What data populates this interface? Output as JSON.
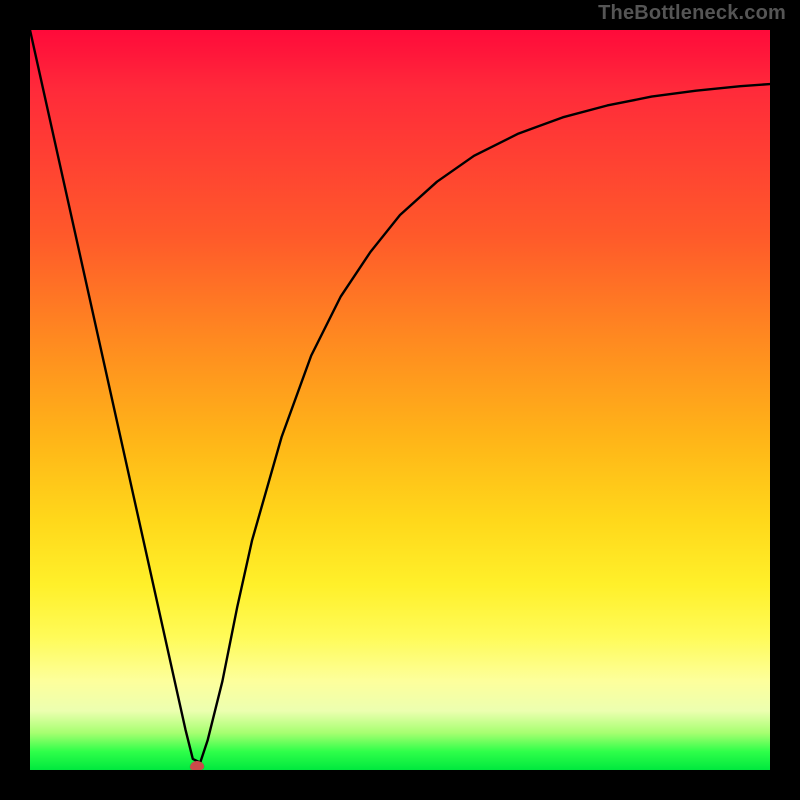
{
  "watermark": "TheBottleneck.com",
  "chart_data": {
    "type": "line",
    "title": "",
    "xlabel": "",
    "ylabel": "",
    "xlim": [
      0,
      100
    ],
    "ylim": [
      0,
      100
    ],
    "grid": false,
    "legend": false,
    "background": {
      "type": "vertical_gradient",
      "stops": [
        {
          "pos": 0.0,
          "color": "#ff0a3a"
        },
        {
          "pos": 0.28,
          "color": "#ff5a2a"
        },
        {
          "pos": 0.55,
          "color": "#ffb418"
        },
        {
          "pos": 0.75,
          "color": "#fff02a"
        },
        {
          "pos": 0.92,
          "color": "#ecffb0"
        },
        {
          "pos": 1.0,
          "color": "#00e83e"
        }
      ]
    },
    "series": [
      {
        "name": "bottleneck-curve",
        "stroke": "#000000",
        "x": [
          0,
          2,
          4,
          6,
          8,
          10,
          12,
          14,
          16,
          18,
          20,
          21,
          22,
          23,
          24,
          26,
          28,
          30,
          34,
          38,
          42,
          46,
          50,
          55,
          60,
          66,
          72,
          78,
          84,
          90,
          96,
          100
        ],
        "y": [
          100,
          91,
          82,
          73,
          64,
          55,
          46,
          37,
          28,
          19,
          10,
          5.5,
          1.5,
          1.0,
          4,
          12,
          22,
          31,
          45,
          56,
          64,
          70,
          75,
          79.5,
          83,
          86,
          88.2,
          89.8,
          91,
          91.8,
          92.4,
          92.7
        ]
      }
    ],
    "markers": [
      {
        "name": "valley-marker",
        "x": 22.5,
        "y": 0.6,
        "shape": "blob",
        "color": "#cc4a4a"
      }
    ]
  }
}
